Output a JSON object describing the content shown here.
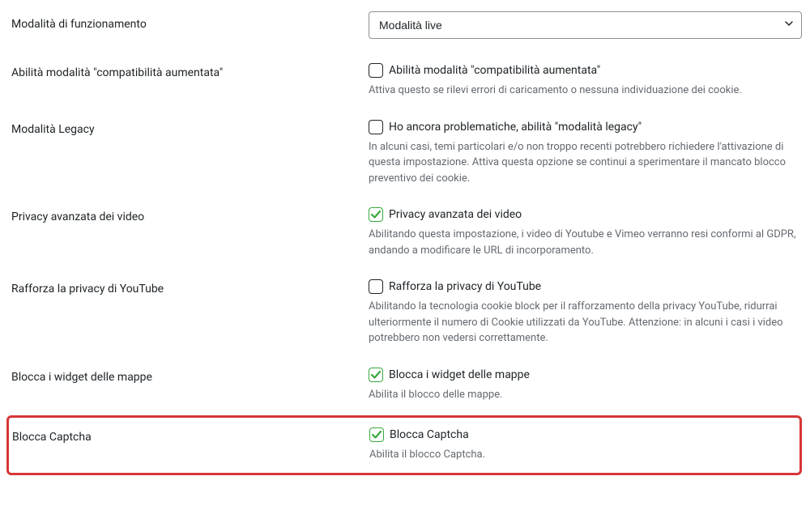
{
  "settings": {
    "operation_mode": {
      "label": "Modalità di funzionamento",
      "selected": "Modalità live"
    },
    "augmented_compat": {
      "label": "Abilità modalità \"compatibilità aumentata\"",
      "checkbox_label": "Abilità modalità \"compatibilità aumentata\"",
      "description": "Attiva questo se rilevi errori di caricamento o nessuna individuazione dei cookie.",
      "checked": false
    },
    "legacy_mode": {
      "label": "Modalità Legacy",
      "checkbox_label": "Ho ancora problematiche, abilità \"modalità legacy\"",
      "description": "In alcuni casi, temi particolari e/o non troppo recenti potrebbero richiedere l'attivazione di questa impostazione. Attiva questa opzione se continui a sperimentare il mancato blocco preventivo dei cookie.",
      "checked": false
    },
    "video_privacy": {
      "label": "Privacy avanzata dei video",
      "checkbox_label": "Privacy avanzata dei video",
      "description": "Abilitando questa impostazione, i video di Youtube e Vimeo verranno resi conformi al GDPR, andando a modificare le URL di incorporamento.",
      "checked": true
    },
    "youtube_privacy": {
      "label": "Rafforza la privacy di YouTube",
      "checkbox_label": "Rafforza la privacy di YouTube",
      "description": "Abilitando la tecnologia cookie block per il rafforzamento della privacy YouTube, ridurrai ulteriormente il numero di Cookie utilizzati da YouTube. Attenzione: in alcuni i casi i video potrebbero non vedersi correttamente.",
      "checked": false
    },
    "block_maps": {
      "label": "Blocca i widget delle mappe",
      "checkbox_label": "Blocca i widget delle mappe",
      "description": "Abilita il blocco delle mappe.",
      "checked": true
    },
    "block_captcha": {
      "label": "Blocca Captcha",
      "checkbox_label": "Blocca Captcha",
      "description": "Abilita il blocco Captcha.",
      "checked": true
    }
  }
}
